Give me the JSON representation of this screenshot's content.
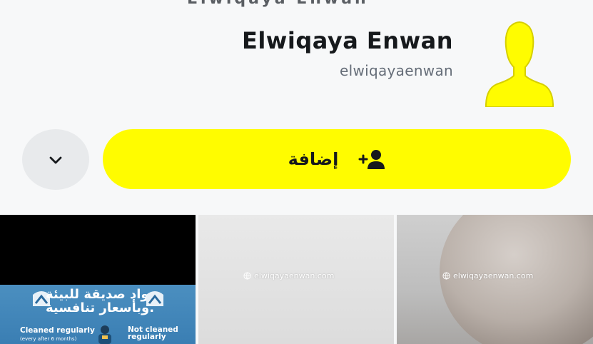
{
  "header": {
    "cut_title": "Elwiqaya Enwan"
  },
  "profile": {
    "display_name": "Elwiqaya Enwan",
    "username": "elwiqayaenwan"
  },
  "actions": {
    "add_label": "إضافة"
  },
  "colors": {
    "accent_yellow": "#fffc00",
    "avatar_yellow": "#fffc00",
    "secondary_button": "#e8eaec"
  },
  "tiles": [
    {
      "arabic_line1": "مواد صديقة للبيئة",
      "arabic_line2": "وبأسعار تنافسية.",
      "cleaned": "Cleaned regularly",
      "cleaned_note": "(every after 6 months)",
      "not_cleaned": "Not cleaned regularly"
    },
    {
      "watermark": "elwiqayaenwan.com"
    },
    {
      "watermark": "elwiqayaenwan.com"
    }
  ],
  "icons": {
    "avatar": "ghost-avatar-icon",
    "chevron": "chevron-down-icon",
    "add_friend": "add-friend-icon",
    "globe": "globe-icon"
  }
}
